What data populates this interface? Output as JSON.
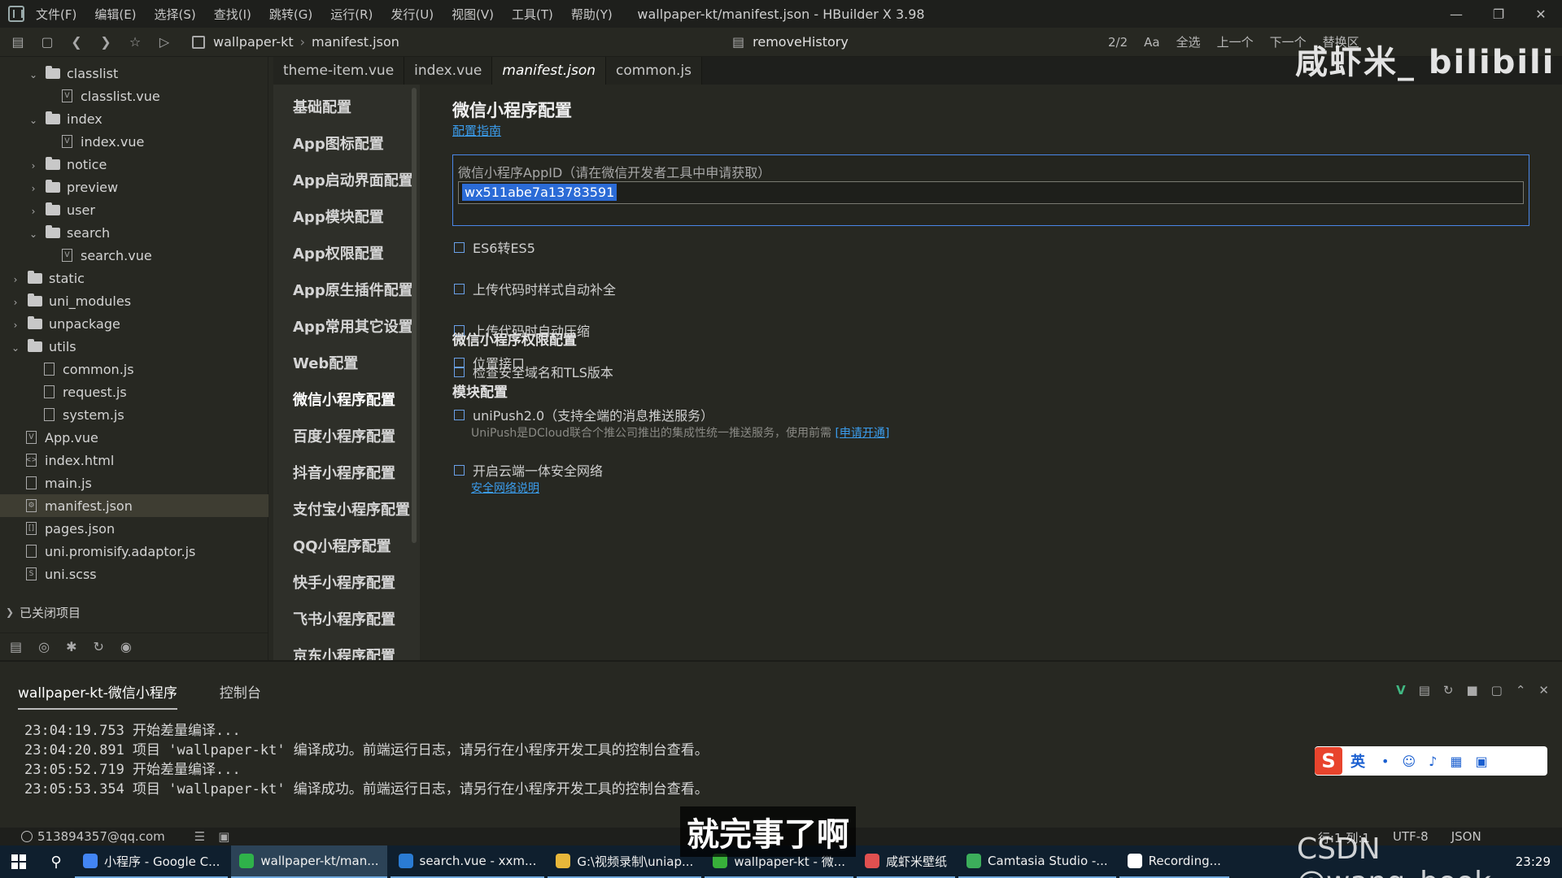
{
  "menubar": {
    "items": [
      "文件(F)",
      "编辑(E)",
      "选择(S)",
      "查找(I)",
      "跳转(G)",
      "运行(R)",
      "发行(U)",
      "视图(V)",
      "工具(T)",
      "帮助(Y)"
    ],
    "window_title": "wallpaper-kt/manifest.json - HBuilder X 3.98"
  },
  "toolbar": {
    "project": "wallpaper-kt",
    "file": "manifest.json",
    "search_history": "removeHistory",
    "right_items": [
      "2/2",
      "Aa",
      "全选",
      "上一个",
      "下一个",
      "替换区"
    ]
  },
  "filetree": {
    "rows": [
      {
        "label": "classlist",
        "type": "folder",
        "open": true,
        "indent": 1
      },
      {
        "label": "classlist.vue",
        "type": "file",
        "indent": 2,
        "badge": "V"
      },
      {
        "label": "index",
        "type": "folder",
        "open": true,
        "indent": 1
      },
      {
        "label": "index.vue",
        "type": "file",
        "indent": 2,
        "badge": "V"
      },
      {
        "label": "notice",
        "type": "folder",
        "open": false,
        "indent": 1
      },
      {
        "label": "preview",
        "type": "folder",
        "open": false,
        "indent": 1
      },
      {
        "label": "user",
        "type": "folder",
        "open": false,
        "indent": 1
      },
      {
        "label": "search",
        "type": "folder",
        "open": true,
        "indent": 1
      },
      {
        "label": "search.vue",
        "type": "file",
        "indent": 2,
        "badge": "V"
      },
      {
        "label": "static",
        "type": "folder",
        "open": false,
        "indent": 0
      },
      {
        "label": "uni_modules",
        "type": "folder",
        "open": false,
        "indent": 0
      },
      {
        "label": "unpackage",
        "type": "folder",
        "open": false,
        "indent": 0
      },
      {
        "label": "utils",
        "type": "folder",
        "open": true,
        "indent": 0
      },
      {
        "label": "common.js",
        "type": "file",
        "indent": 1,
        "badge": ""
      },
      {
        "label": "request.js",
        "type": "file",
        "indent": 1,
        "badge": ""
      },
      {
        "label": "system.js",
        "type": "file",
        "indent": 1,
        "badge": ""
      },
      {
        "label": "App.vue",
        "type": "file",
        "indent": 0,
        "badge": "V"
      },
      {
        "label": "index.html",
        "type": "file",
        "indent": 0,
        "badge": "<>"
      },
      {
        "label": "main.js",
        "type": "file",
        "indent": 0,
        "badge": ""
      },
      {
        "label": "manifest.json",
        "type": "file",
        "indent": 0,
        "badge": "⚙",
        "selected": true
      },
      {
        "label": "pages.json",
        "type": "file",
        "indent": 0,
        "badge": "[]"
      },
      {
        "label": "uni.promisify.adaptor.js",
        "type": "file",
        "indent": 0,
        "badge": ""
      },
      {
        "label": "uni.scss",
        "type": "file",
        "indent": 0,
        "badge": "S"
      }
    ],
    "closed_projects": "已关闭项目"
  },
  "tabs": [
    {
      "label": "theme-item.vue",
      "active": false
    },
    {
      "label": "index.vue",
      "active": false
    },
    {
      "label": "manifest.json",
      "active": true
    },
    {
      "label": "common.js",
      "active": false
    }
  ],
  "config_nav": [
    "基础配置",
    "App图标配置",
    "App启动界面配置",
    "App模块配置",
    "App权限配置",
    "App原生插件配置",
    "App常用其它设置",
    "Web配置",
    "微信小程序配置",
    "百度小程序配置",
    "抖音小程序配置",
    "支付宝小程序配置",
    "QQ小程序配置",
    "快手小程序配置",
    "飞书小程序配置",
    "京东小程序配置"
  ],
  "config_nav_active": "微信小程序配置",
  "main": {
    "title": "微信小程序配置",
    "guide_link": "配置指南",
    "appid_label": "微信小程序AppID（请在微信开发者工具中申请获取）",
    "appid_value": "wx511abe7a13783591",
    "checks": [
      "ES6转ES5",
      "上传代码时样式自动补全",
      "上传代码时自动压缩",
      "检查安全域名和TLS版本"
    ],
    "perm_title": "微信小程序权限配置",
    "perm_check": "位置接口",
    "module_title": "模块配置",
    "uni_push": "uniPush2.0（支持全端的消息推送服务）",
    "uni_push_desc": "UniPush是DCloud联合个推公司推出的集成性统一推送服务，使用前需",
    "uni_push_desc_link": "[申请开通]",
    "cloud_secure": "开启云端一体安全网络",
    "cloud_secure_link": "安全网络说明"
  },
  "console": {
    "tabs": [
      "wallpaper-kt-微信小程序",
      "控制台"
    ],
    "lines": [
      "23:04:19.753 开始差量编译...",
      "23:04:20.891 项目 'wallpaper-kt' 编译成功。前端运行日志，请另行在小程序开发工具的控制台查看。",
      "23:05:52.719 开始差量编译...",
      "23:05:53.354 项目 'wallpaper-kt' 编译成功。前端运行日志，请另行在小程序开发工具的控制台查看。"
    ]
  },
  "statusbar": {
    "user": "513894357@qq.com",
    "position": "行:1  列:1",
    "encoding": "UTF-8",
    "lang": "JSON"
  },
  "taskbar": {
    "items": [
      {
        "label": "小程序 - Google C...",
        "color": "#4285f4"
      },
      {
        "label": "wallpaper-kt/man...",
        "color": "#2fb24a",
        "active": true
      },
      {
        "label": "search.vue - xxm...",
        "color": "#2a7bd3"
      },
      {
        "label": "G:\\视频录制\\uniap...",
        "color": "#e8b73a"
      },
      {
        "label": "wallpaper-kt - 微...",
        "color": "#38b03a"
      },
      {
        "label": "咸虾米壁纸",
        "color": "#e05050"
      },
      {
        "label": "Camtasia Studio -...",
        "color": "#3cae5b"
      },
      {
        "label": "Recording...",
        "color": "#ffffff"
      }
    ],
    "time": "23:29"
  },
  "overlays": {
    "subtitle": "就完事了啊",
    "watermark": "咸虾米_ bilibili",
    "csdn": "CSDN @wang_book",
    "ime_lang": "英"
  }
}
